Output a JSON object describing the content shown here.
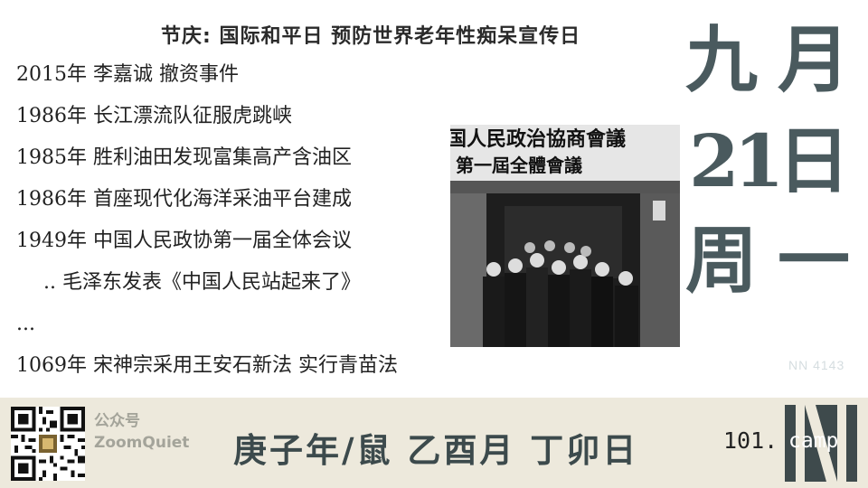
{
  "holidays": "节庆:  国际和平日 预防世界老年性痴呆宣传日",
  "events": [
    "2015年 李嘉诚 撤资事件",
    "1986年 长江漂流队征服虎跳峡",
    "1985年 胜利油田发现富集高产含油区",
    "1986年 首座现代化海洋采油平台建成",
    "1949年 中国人民政协第一届全体会议",
    ".. 毛泽东发表《中国人民站起来了》",
    "...",
    "1069年 宋神宗采用王安石新法 实行青苗法"
  ],
  "photo": {
    "banner_line1": "国人民政治協商會議",
    "banner_line2": "第一屆全體會議"
  },
  "date": {
    "month_num": "九",
    "month_char": "月",
    "day_num": "21",
    "day_char": "日",
    "week_char": "周",
    "weekday": "一"
  },
  "nn_code": "NN 4143",
  "footer": {
    "wechat_label": "公众号",
    "wechat_name": "ZoomQuiet",
    "ganzhi": "庚子年/鼠 乙酉月 丁卯日",
    "camp_number": "101.",
    "camp_word": "camp"
  }
}
